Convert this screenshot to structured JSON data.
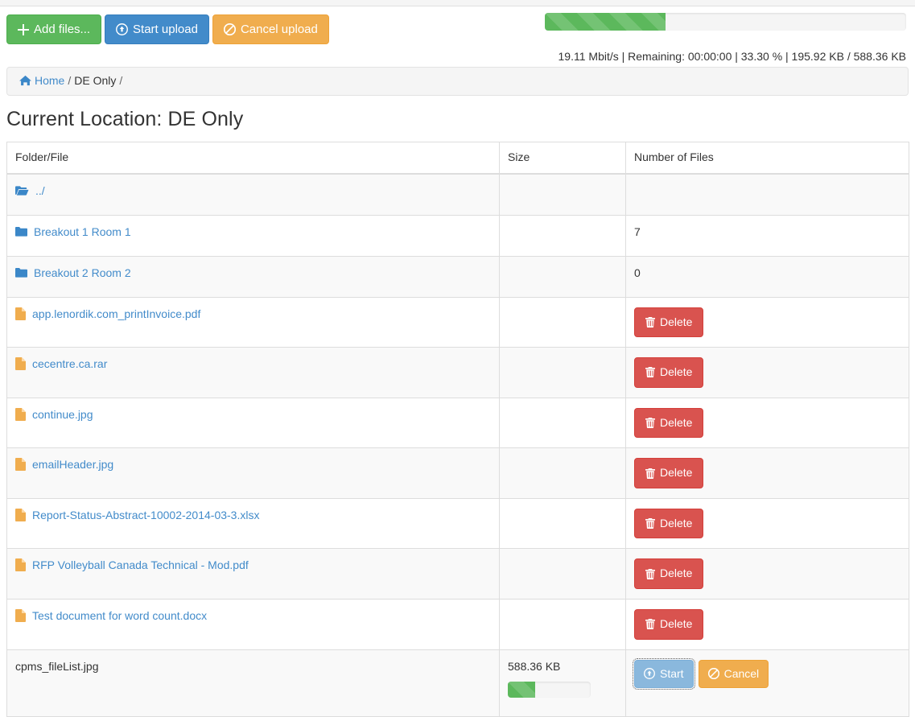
{
  "toolbar": {
    "add_files_label": "Add files...",
    "start_upload_label": "Start upload",
    "cancel_upload_label": "Cancel upload"
  },
  "upload_progress": {
    "percent": 33.3,
    "percent_text": "33.30 %",
    "speed": "19.11 Mbit/s",
    "remaining_label": "Remaining: 00:00:00",
    "uploaded": "195.92 KB",
    "total": "588.36 KB",
    "stats_text": "19.11 Mbit/s | Remaining: 00:00:00 | 33.30 % | 195.92 KB / 588.36 KB",
    "bar_color": "#5cb85c"
  },
  "breadcrumb": {
    "home_label": "Home",
    "separator": "/",
    "current": "DE Only",
    "trailing": "/"
  },
  "page_title": "Current Location: DE Only",
  "table": {
    "headers": {
      "name": "Folder/File",
      "size": "Size",
      "count": "Number of Files"
    },
    "rows": [
      {
        "icon": "folder-open-icon",
        "name": "../",
        "size": "",
        "count": "",
        "action": "none"
      },
      {
        "icon": "folder-icon",
        "name": "Breakout 1 Room 1",
        "size": "",
        "count": "7",
        "action": "none"
      },
      {
        "icon": "folder-icon",
        "name": "Breakout 2 Room 2",
        "size": "",
        "count": "0",
        "action": "none"
      },
      {
        "icon": "file-icon",
        "name": "app.lenordik.com_printInvoice.pdf",
        "size": "",
        "count": "",
        "action": "delete"
      },
      {
        "icon": "file-icon",
        "name": "cecentre.ca.rar",
        "size": "",
        "count": "",
        "action": "delete"
      },
      {
        "icon": "file-icon",
        "name": "continue.jpg",
        "size": "",
        "count": "",
        "action": "delete"
      },
      {
        "icon": "file-icon",
        "name": "emailHeader.jpg",
        "size": "",
        "count": "",
        "action": "delete"
      },
      {
        "icon": "file-icon",
        "name": "Report-Status-Abstract-10002-2014-03-3.xlsx",
        "size": "",
        "count": "",
        "action": "delete"
      },
      {
        "icon": "file-icon",
        "name": "RFP Volleyball Canada Technical - Mod.pdf",
        "size": "",
        "count": "",
        "action": "delete"
      },
      {
        "icon": "file-icon",
        "name": "Test document for word count.docx",
        "size": "",
        "count": "",
        "action": "delete"
      }
    ],
    "delete_label": "Delete",
    "pending_upload": {
      "name": "cpms_fileList.jpg",
      "size": "588.36 KB",
      "progress_percent": 33.3,
      "start_label": "Start",
      "cancel_label": "Cancel"
    }
  },
  "colors": {
    "success": "#5cb85c",
    "primary": "#428bca",
    "warning": "#f0ad4e",
    "danger": "#d9534f",
    "link": "#428bca",
    "folder": "#3b87c8",
    "file": "#f0ad4e"
  }
}
